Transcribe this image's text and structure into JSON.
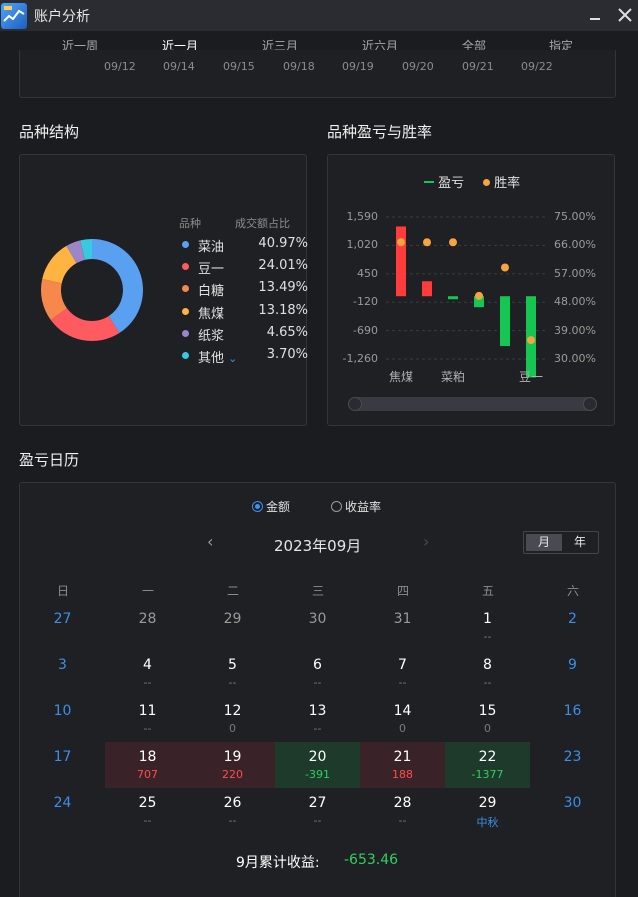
{
  "window": {
    "title": "账户分析"
  },
  "tabs": [
    "近一周",
    "近一月",
    "近三月",
    "近六月",
    "全部",
    "指定"
  ],
  "top_dates": [
    "09/12",
    "09/14",
    "09/15",
    "09/18",
    "09/19",
    "09/20",
    "09/21",
    "09/22"
  ],
  "structure": {
    "title": "品种结构",
    "head_name": "品种",
    "head_pct": "成交额占比",
    "expand_symbol": "⌄"
  },
  "pnl": {
    "title": "品种盈亏与胜率",
    "legend_pnl": "盈亏",
    "legend_win": "胜率"
  },
  "calendar": {
    "title": "盈亏日历",
    "mode_amount": "金额",
    "mode_rate": "收益率",
    "month": "2023年09月",
    "prev": "‹",
    "next": "›",
    "view_month": "月",
    "view_year": "年",
    "weekdays": [
      "日",
      "一",
      "二",
      "三",
      "四",
      "五",
      "六"
    ],
    "total_label": "9月累计收益:",
    "total_value": "-653.46"
  },
  "colors": {
    "profit": "#ff3b3b",
    "loss": "#16c653",
    "win_rate": "#f6a340"
  },
  "chart_data": [
    {
      "type": "pie",
      "style": "donut",
      "labels": [
        "菜油",
        "豆一",
        "白糖",
        "焦煤",
        "纸浆",
        "其他"
      ],
      "values": [
        40.97,
        24.01,
        13.49,
        13.18,
        4.65,
        3.7
      ],
      "display": [
        "40.97%",
        "24.01%",
        "13.49%",
        "13.18%",
        "4.65%",
        "3.70%"
      ],
      "colors": [
        "#5aa0f0",
        "#ff5a5f",
        "#f5884a",
        "#ffb340",
        "#9a86c8",
        "#38c8e0"
      ]
    },
    {
      "type": "bar",
      "categories": [
        "焦煤",
        "",
        "菜粕",
        "",
        "",
        "豆一"
      ],
      "tick_labels": [
        "焦煤",
        "菜粕",
        "豆一"
      ],
      "series": [
        {
          "name": "盈亏",
          "values": [
            1400,
            300,
            -60,
            -220,
            -1000,
            -1630
          ]
        },
        {
          "name": "胜率",
          "values": [
            67,
            67,
            67,
            null,
            59,
            36
          ]
        }
      ],
      "points_on_zero": [
        50,
        45
      ],
      "y_left_ticks": [
        "1,590",
        "1,020",
        "450",
        "-120",
        "-690",
        "-1,260"
      ],
      "y_right_ticks": [
        "75.00%",
        "66.00%",
        "57.00%",
        "48.00%",
        "39.00%",
        "30.00%"
      ],
      "ylim": [
        -1260,
        1590
      ],
      "y2lim": [
        30,
        75
      ]
    }
  ],
  "calendar_days": [
    {
      "d": "27",
      "s": "",
      "cls": "weekend"
    },
    {
      "d": "28",
      "s": "",
      "cls": "other"
    },
    {
      "d": "29",
      "s": "",
      "cls": "other"
    },
    {
      "d": "30",
      "s": "",
      "cls": "other"
    },
    {
      "d": "31",
      "s": "",
      "cls": "other"
    },
    {
      "d": "1",
      "s": "--",
      "cls": ""
    },
    {
      "d": "2",
      "s": "",
      "cls": "weekend"
    },
    {
      "d": "3",
      "s": "",
      "cls": "weekend"
    },
    {
      "d": "4",
      "s": "--",
      "cls": ""
    },
    {
      "d": "5",
      "s": "--",
      "cls": ""
    },
    {
      "d": "6",
      "s": "--",
      "cls": ""
    },
    {
      "d": "7",
      "s": "--",
      "cls": ""
    },
    {
      "d": "8",
      "s": "--",
      "cls": ""
    },
    {
      "d": "9",
      "s": "",
      "cls": "weekend"
    },
    {
      "d": "10",
      "s": "",
      "cls": "weekend"
    },
    {
      "d": "11",
      "s": "--",
      "cls": ""
    },
    {
      "d": "12",
      "s": "0",
      "cls": ""
    },
    {
      "d": "13",
      "s": "--",
      "cls": ""
    },
    {
      "d": "14",
      "s": "0",
      "cls": ""
    },
    {
      "d": "15",
      "s": "0",
      "cls": ""
    },
    {
      "d": "16",
      "s": "",
      "cls": "weekend"
    },
    {
      "d": "17",
      "s": "",
      "cls": "weekend"
    },
    {
      "d": "18",
      "s": "707",
      "cls": "profit"
    },
    {
      "d": "19",
      "s": "220",
      "cls": "profit"
    },
    {
      "d": "20",
      "s": "-391",
      "cls": "loss"
    },
    {
      "d": "21",
      "s": "188",
      "cls": "profit"
    },
    {
      "d": "22",
      "s": "-1377",
      "cls": "loss"
    },
    {
      "d": "23",
      "s": "",
      "cls": "weekend"
    },
    {
      "d": "24",
      "s": "",
      "cls": "weekend"
    },
    {
      "d": "25",
      "s": "--",
      "cls": ""
    },
    {
      "d": "26",
      "s": "--",
      "cls": ""
    },
    {
      "d": "27",
      "s": "--",
      "cls": ""
    },
    {
      "d": "28",
      "s": "--",
      "cls": ""
    },
    {
      "d": "29",
      "s": "中秋",
      "cls": "holiday"
    },
    {
      "d": "30",
      "s": "",
      "cls": "weekend"
    }
  ]
}
